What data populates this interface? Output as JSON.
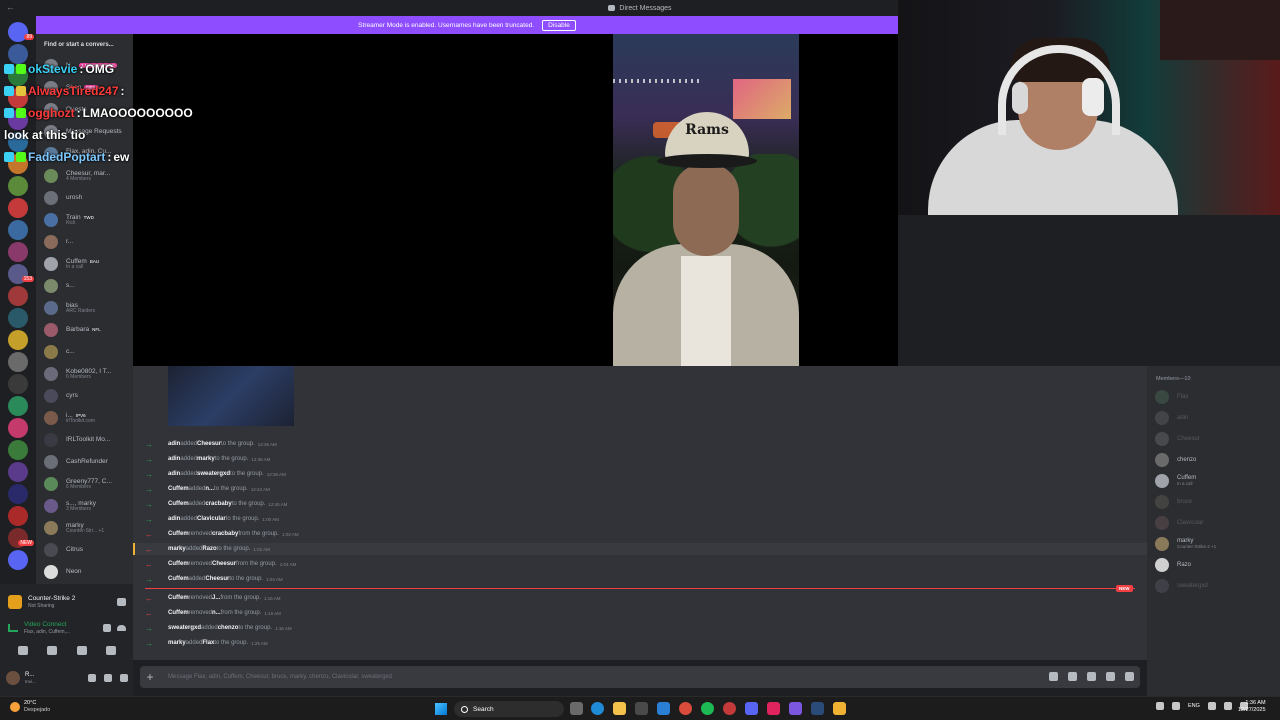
{
  "window": {
    "title": "Direct Messages"
  },
  "banner": {
    "text": "Streamer Mode is enabled. Usernames have been truncated.",
    "button": "Disable"
  },
  "rail": {
    "badges": [
      "89",
      "NEW",
      "153",
      "NEW"
    ]
  },
  "sidebar": {
    "search": "Find or start a convers...",
    "items": [
      {
        "name": "N...",
        "sub": "",
        "tag": "1 MONTH FREE",
        "color": "#7a7d86"
      },
      {
        "name": "Shop",
        "sub": "",
        "tag": "NEW",
        "color": "#7a7d86"
      },
      {
        "name": "Quests",
        "sub": "",
        "tag": "",
        "color": "#7a7d86"
      },
      {
        "name": "Message Requests",
        "sub": "",
        "tag": "",
        "color": "#7a7d86"
      },
      {
        "name": "Flax, adin, Cu...",
        "sub": "10 Members",
        "tag": "",
        "color": "#5a7a9a"
      },
      {
        "name": "Cheesur, mar...",
        "sub": "4 Members",
        "tag": "",
        "color": "#6a8a5a"
      },
      {
        "name": "urosh",
        "sub": "",
        "tag": "",
        "color": "#6b6f78"
      },
      {
        "name": "Train",
        "sub": "Kick",
        "tag": "TWD",
        "color": "#4a6fa5"
      },
      {
        "name": "r...",
        "sub": "",
        "tag": "",
        "color": "#8a6a5a"
      },
      {
        "name": "Cuffem",
        "sub": "In a call",
        "tag": "BAU",
        "color": "#a0a4aa"
      },
      {
        "name": "s...",
        "sub": "",
        "tag": "",
        "color": "#7a8a6a"
      },
      {
        "name": "bias",
        "sub": "ARC Raiders",
        "tag": "",
        "color": "#5a6a8a"
      },
      {
        "name": "Barbara",
        "sub": "",
        "tag": "NFL",
        "color": "#9a5a6a"
      },
      {
        "name": "c...",
        "sub": "",
        "tag": "",
        "color": "#8a7a4a"
      },
      {
        "name": "Kobe0802, I T...",
        "sub": "6 Members",
        "tag": "",
        "color": "#6a6a7a"
      },
      {
        "name": "cyrs",
        "sub": "",
        "tag": "",
        "color": "#4a4a5a"
      },
      {
        "name": "i...",
        "sub": "irlToolkit.com",
        "tag": "IPV6",
        "color": "#7a5a4a"
      },
      {
        "name": "IRLToolkit Mo...",
        "sub": "",
        "tag": "",
        "color": "#3a3a44"
      },
      {
        "name": "CashRefunder",
        "sub": "",
        "tag": "",
        "color": "#6a6e76"
      },
      {
        "name": "Greeny777, C...",
        "sub": "6 Members",
        "tag": "",
        "color": "#5a8a5a"
      },
      {
        "name": "s..., marky",
        "sub": "3 Members",
        "tag": "",
        "color": "#6a5a8a"
      },
      {
        "name": "marky",
        "sub": "Counter-Stri... +1",
        "tag": "",
        "color": "#8a7a5a"
      },
      {
        "name": "Citrus",
        "sub": "",
        "tag": "",
        "color": "#4a4a52"
      },
      {
        "name": "Neon",
        "sub": "",
        "tag": "",
        "color": "#dcdcdc"
      }
    ]
  },
  "activity": {
    "title": "Counter-Strike 2",
    "sub": "Not Sharing"
  },
  "voice": {
    "title": "Video Connect",
    "sub": "Flax, adin, Cuffem,..."
  },
  "me": {
    "name": "R...",
    "sub": "Invi..."
  },
  "overlay_chat": [
    {
      "user": "okStevie",
      "sep": " : ",
      "msg": "OMG",
      "color": "#3ad1f5"
    },
    {
      "user": "AlwaysTired247",
      "sep": " : ",
      "msg": "",
      "color": "#ff3b3b"
    },
    {
      "user": "ogghozt",
      "sep": " : ",
      "msg": "LMAOOOOOOOOO",
      "color": "#ff3b3b"
    },
    {
      "user": "",
      "sep": "",
      "msg": "look at this tio",
      "color": "#ffffff"
    },
    {
      "user": "FadedPoptart",
      "sep": " : ",
      "msg": "ew",
      "color": "#7ec8ff"
    }
  ],
  "camera": {
    "hat_text": "Rams"
  },
  "messages": [
    {
      "type": "add",
      "actor": "adin",
      "verb": " added ",
      "target": "Cheesur",
      "tail": " to the group.",
      "time": "12:36 AM"
    },
    {
      "type": "add",
      "actor": "adin",
      "verb": " added ",
      "target": "marky",
      "tail": " to the group.",
      "time": "12:36 AM"
    },
    {
      "type": "add",
      "actor": "adin",
      "verb": " added ",
      "target": "sweatergxd",
      "tail": " to the group.",
      "time": "12:36 AM"
    },
    {
      "type": "add",
      "actor": "Cuffem",
      "verb": " added ",
      "target": "n...",
      "tail": " to the group.",
      "time": "12:43 AM"
    },
    {
      "type": "add",
      "actor": "Cuffem",
      "verb": " added ",
      "target": "cracbaby",
      "tail": " to the group.",
      "time": "12:45 AM"
    },
    {
      "type": "add",
      "actor": "adin",
      "verb": " added ",
      "target": "Clavicular",
      "tail": " to the group.",
      "time": "1:00 AM"
    },
    {
      "type": "rem",
      "actor": "Cuffem",
      "verb": " removed ",
      "target": "cracbaby",
      "tail": " from the group.",
      "time": "1:02 AM"
    },
    {
      "type": "rem",
      "actor": "marky",
      "verb": " added ",
      "target": "Razo",
      "tail": " to the group.",
      "time": "1:02 AM"
    },
    {
      "type": "rem",
      "actor": "Cuffem",
      "verb": " removed ",
      "target": "Cheesur",
      "tail": " from the group.",
      "time": "1:04 AM"
    },
    {
      "type": "add",
      "actor": "Cuffem",
      "verb": " added ",
      "target": "Cheesur",
      "tail": " to the group.",
      "time": "1:04 AM"
    },
    {
      "type": "rem",
      "actor": "Cuffem",
      "verb": " removed ",
      "target": "J...",
      "tail": " from the group.",
      "time": "1:16 AM"
    },
    {
      "type": "rem",
      "actor": "Cuffem",
      "verb": " removed ",
      "target": "n...",
      "tail": " from the group.",
      "time": "1:16 AM"
    },
    {
      "type": "add",
      "actor": "sweatergxd",
      "verb": " added ",
      "target": "chenzo",
      "tail": " to the group.",
      "time": "1:16 AM"
    },
    {
      "type": "add",
      "actor": "marky",
      "verb": " added ",
      "target": "Flax",
      "tail": " to the group.",
      "time": "1:25 AM"
    }
  ],
  "new_label": "NEW",
  "composer": {
    "placeholder": "Message Flax, adin, Cuffem, Cheesur, bruce, marky, chenzo, Clavicular, sweatergxd"
  },
  "members": {
    "header": "Members—10",
    "items": [
      {
        "name": "Flax",
        "sub": "",
        "offline": true,
        "color": "#5a8a6a"
      },
      {
        "name": "adin",
        "sub": "",
        "offline": true,
        "color": "#7a7a7a"
      },
      {
        "name": "Cheesur",
        "sub": "",
        "offline": true,
        "color": "#8a8a8a"
      },
      {
        "name": "chenzo",
        "sub": "",
        "offline": false,
        "color": "#6a6a6a"
      },
      {
        "name": "Cuffem",
        "sub": "In a call",
        "offline": false,
        "color": "#a0a4aa"
      },
      {
        "name": "bruce",
        "sub": "",
        "offline": true,
        "color": "#7a7a6a"
      },
      {
        "name": "Clavicular",
        "sub": "",
        "offline": true,
        "color": "#8a6a6a"
      },
      {
        "name": "marky",
        "sub": "Counter-Strike 2 +1",
        "offline": false,
        "color": "#8a7a5a"
      },
      {
        "name": "Razo",
        "sub": "",
        "offline": false,
        "color": "#d0d0d0"
      },
      {
        "name": "sweatergxd",
        "sub": "",
        "offline": true,
        "color": "#6a6a7a"
      }
    ]
  },
  "taskbar": {
    "temp": "20°C",
    "weather": "Despejado",
    "search": "Search",
    "lang": "ENG",
    "time": "1:36 AM",
    "date": "12/27/2025"
  }
}
